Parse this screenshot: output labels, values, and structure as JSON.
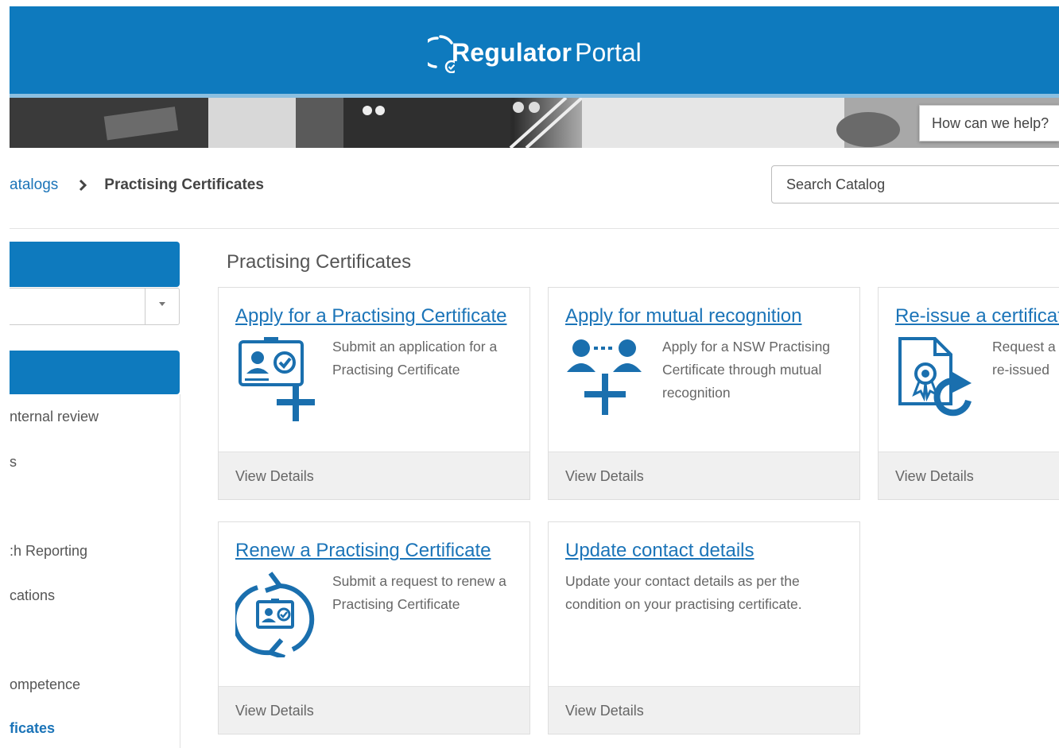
{
  "header": {
    "logo_bold": "Regulator",
    "logo_light": "Portal"
  },
  "banner": {
    "help_text": "How can we help?"
  },
  "breadcrumb": {
    "parent": "atalogs",
    "current": "Practising Certificates"
  },
  "search": {
    "placeholder": "Search Catalog"
  },
  "sidebar": {
    "items": [
      {
        "label": "nternal review"
      },
      {
        "label": "s"
      },
      {
        "label": ":h Reporting"
      },
      {
        "label": "cations"
      },
      {
        "label": "ompetence"
      },
      {
        "label": "ficates"
      }
    ]
  },
  "main": {
    "section_title": "Practising Certificates",
    "cards": [
      {
        "title": "Apply for a Practising Certificate",
        "description": "Submit an application for a Practising Certificate",
        "footer": "View Details",
        "icon": "certificate-add-icon"
      },
      {
        "title": "Apply for mutual recognition",
        "description": "Apply for a NSW Practising Certificate through mutual recognition",
        "footer": "View Details",
        "icon": "people-add-icon"
      },
      {
        "title": "Re-issue a certificat",
        "description": "Request a re-issued",
        "footer": "View Details",
        "icon": "document-reissue-icon"
      },
      {
        "title": "Renew a Practising Certificate",
        "description": "Submit a request to renew a Practising Certificate",
        "footer": "View Details",
        "icon": "renew-certificate-icon"
      },
      {
        "title": "Update contact details",
        "description": "Update your contact details as per the condition on your practising certificate.",
        "footer": "View Details"
      }
    ]
  },
  "colors": {
    "brand_blue": "#0e7abe",
    "link_blue": "#1b74b8",
    "icon_blue": "#1a6fae"
  }
}
